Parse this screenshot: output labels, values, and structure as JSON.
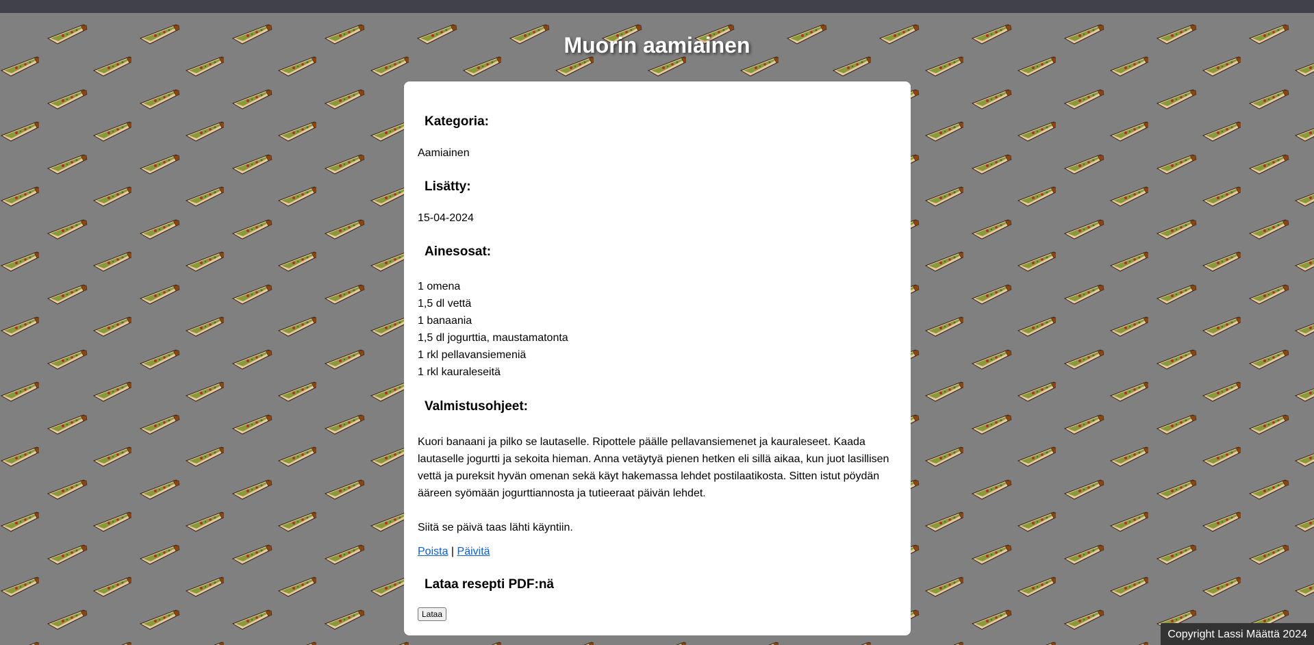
{
  "page": {
    "title": "Muorin aamiainen"
  },
  "recipe": {
    "category_heading": "Kategoria:",
    "category_value": "Aamiainen",
    "added_heading": "Lisätty:",
    "added_value": "15-04-2024",
    "ingredients_heading": "Ainesosat:",
    "ingredients": [
      "1 omena",
      "1,5 dl vettä",
      "1 banaania",
      "1,5 dl jogurttia, maustamatonta",
      "1 rkl pellavansiemeniä",
      "1 rkl kauraleseitä"
    ],
    "instructions_heading": "Valmistusohjeet:",
    "instructions_paragraphs": [
      "Kuori banaani ja pilko se lautaselle. Ripottele päälle pellavansiemenet ja kauraleseet. Kaada lautaselle jogurtti ja sekoita hieman. Anna vetäytyä pienen hetken eli sillä aikaa, kun juot lasillisen vettä ja pureksit hyvän omenan sekä käyt hakemassa lehdet postilaatikosta. Sitten istut pöydän ääreen syömään jogurttiannosta ja tutieeraat päivän lehdet.",
      "Siitä se päivä taas lähti käyntiin."
    ]
  },
  "actions": {
    "delete_label": "Poista",
    "separator": "|",
    "update_label": "Päivitä"
  },
  "pdf": {
    "heading": "Lataa resepti PDF:nä",
    "button_label": "Lataa"
  },
  "footer": {
    "copyright": "Copyright Lassi Määttä 2024"
  },
  "colors": {
    "top_bar": "#414149",
    "background": "#808080",
    "card": "#ffffff",
    "link": "#0b5ed7",
    "footer_bg": "#333333"
  },
  "background_pattern_icon": "pizza-slice-icon"
}
